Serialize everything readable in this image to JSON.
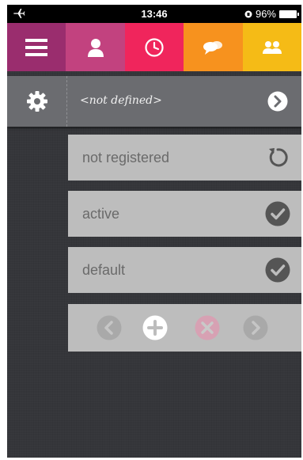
{
  "status_bar": {
    "time": "13:46",
    "battery": "96%",
    "icons": [
      "airplane-icon",
      "orientation-lock-icon",
      "battery-icon"
    ]
  },
  "tabs": [
    {
      "icon": "menu-icon",
      "color": "#9a2d6e"
    },
    {
      "icon": "person-icon",
      "color": "#c2427f"
    },
    {
      "icon": "clock-icon",
      "color": "#f0255c"
    },
    {
      "icon": "chat-bubbles-icon",
      "color": "#f7921e"
    },
    {
      "icon": "group-icon",
      "color": "#f5bb16"
    }
  ],
  "device": {
    "name": "<not defined>",
    "settings_icon": "gear-icon",
    "go_icon": "chevron-right-circle-icon"
  },
  "rows": [
    {
      "label": "not registered",
      "icon": "refresh-icon"
    },
    {
      "label": "active",
      "icon": "check-circle-icon"
    },
    {
      "label": "default",
      "icon": "check-circle-icon"
    }
  ],
  "nav": {
    "icons": [
      "back-circle-icon",
      "add-circle-icon",
      "delete-circle-icon",
      "forward-circle-icon"
    ]
  }
}
